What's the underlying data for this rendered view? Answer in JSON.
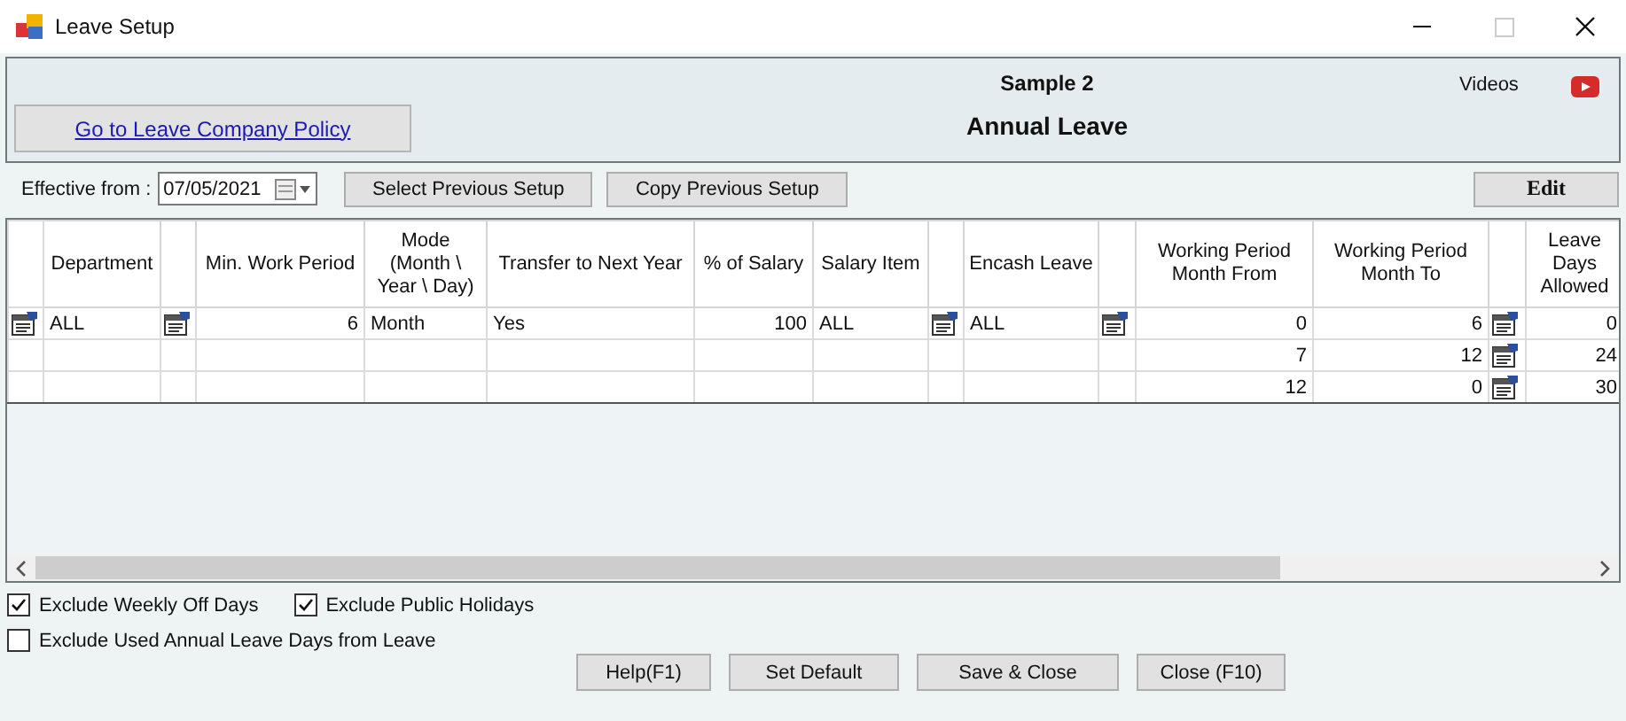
{
  "window": {
    "title": "Leave Setup"
  },
  "header": {
    "link": "Go to Leave Company Policy",
    "company": "Sample 2",
    "leave_type": "Annual Leave",
    "videos_label": "Videos"
  },
  "toolbar": {
    "effective_label": "Effective from :",
    "effective_date": "07/05/2021",
    "buttons": [
      "Select Previous Setup",
      "Copy Previous Setup"
    ],
    "edit_button": "Edit"
  },
  "table": {
    "columns": [
      {
        "kind": "text",
        "header": "Department"
      },
      {
        "kind": "picker"
      },
      {
        "kind": "number",
        "header": "Min. Work Period"
      },
      {
        "kind": "text",
        "header": "Mode\n(Month \\\nYear \\ Day)"
      },
      {
        "kind": "text",
        "header": "Transfer to Next Year"
      },
      {
        "kind": "number",
        "header": "% of Salary"
      },
      {
        "kind": "text",
        "header": "Salary Item"
      },
      {
        "kind": "picker"
      },
      {
        "kind": "text",
        "header": "Encash Leave"
      },
      {
        "kind": "picker"
      },
      {
        "kind": "number",
        "header": "Working Period\nMonth From"
      },
      {
        "kind": "number",
        "header": "Working Period\nMonth To"
      },
      {
        "kind": "picker"
      },
      {
        "kind": "number",
        "header": "Leave\nDays\nAllowed"
      }
    ],
    "rows": [
      {
        "indicator": true,
        "cells": [
          "ALL",
          true,
          "6",
          "Month",
          "Yes",
          "100",
          "ALL",
          true,
          "ALL",
          true,
          "0",
          "6",
          true,
          "0"
        ]
      },
      {
        "indicator": false,
        "cells": [
          null,
          false,
          null,
          null,
          null,
          null,
          null,
          false,
          null,
          false,
          "7",
          "12",
          true,
          "24"
        ]
      },
      {
        "indicator": false,
        "cells": [
          null,
          false,
          null,
          null,
          null,
          null,
          null,
          false,
          null,
          false,
          "12",
          "0",
          true,
          "30"
        ]
      }
    ]
  },
  "options": [
    {
      "label": "Exclude Weekly Off Days",
      "checked": true
    },
    {
      "label": "Exclude Public Holidays",
      "checked": true
    },
    {
      "label": "Exclude Used Annual Leave Days from Leave",
      "checked": false
    }
  ],
  "buttons": [
    "Help(F1)",
    "Set Default",
    "Save & Close",
    "Close (F10)"
  ]
}
